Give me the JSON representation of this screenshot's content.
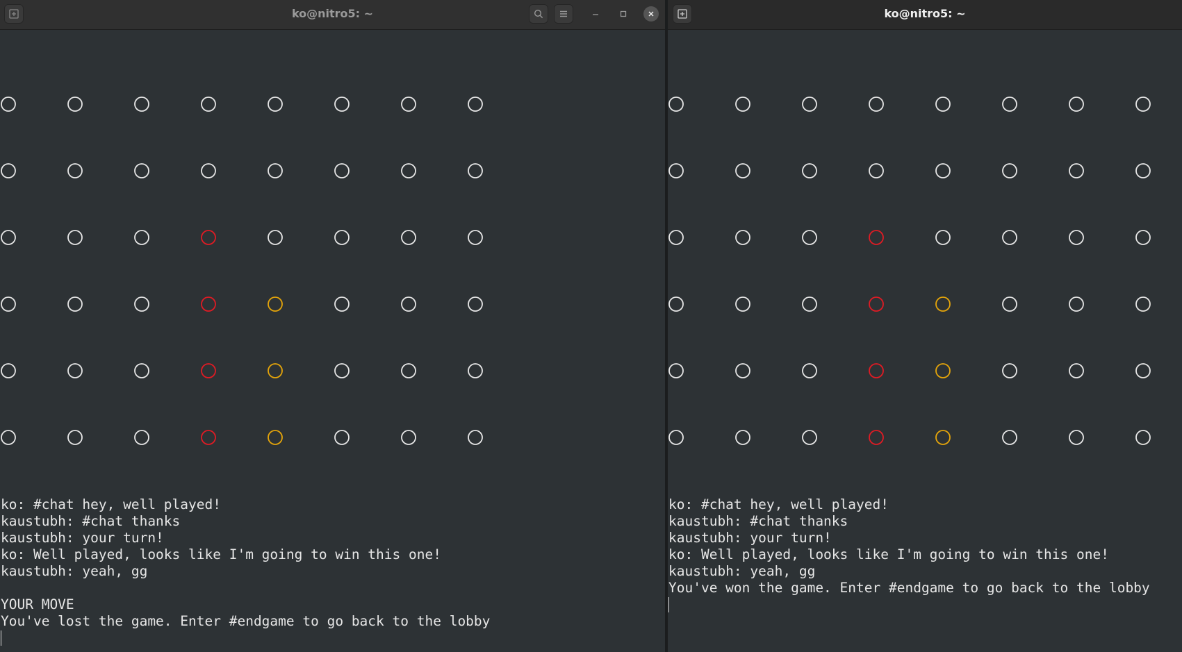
{
  "colors": {
    "background": "#2d3235",
    "text": "#e6e6e6",
    "empty_slot": "#e6e6e6",
    "red_piece": "#e01b24",
    "yellow_piece": "#e5a50a"
  },
  "board": {
    "rows": 6,
    "cols": 8,
    "cells": [
      [
        "empty",
        "empty",
        "empty",
        "empty",
        "empty",
        "empty",
        "empty",
        "empty"
      ],
      [
        "empty",
        "empty",
        "empty",
        "empty",
        "empty",
        "empty",
        "empty",
        "empty"
      ],
      [
        "empty",
        "empty",
        "empty",
        "red",
        "empty",
        "empty",
        "empty",
        "empty"
      ],
      [
        "empty",
        "empty",
        "empty",
        "red",
        "yellow",
        "empty",
        "empty",
        "empty"
      ],
      [
        "empty",
        "empty",
        "empty",
        "red",
        "yellow",
        "empty",
        "empty",
        "empty"
      ],
      [
        "empty",
        "empty",
        "empty",
        "red",
        "yellow",
        "empty",
        "empty",
        "empty"
      ]
    ]
  },
  "windows": {
    "left": {
      "title": "ko@nitro5: ~",
      "new_tab_icon": "new-tab-icon",
      "search_icon": "search-icon",
      "menu_icon": "hamburger-menu-icon",
      "minimize_icon": "minimize-icon",
      "maximize_icon": "maximize-icon",
      "close_icon": "close-icon",
      "lines": [
        "ko: #chat hey, well played!",
        "kaustubh: #chat thanks",
        "kaustubh: your turn!",
        "ko: Well played, looks like I'm going to win this one!",
        "kaustubh: yeah, gg",
        "",
        "YOUR MOVE",
        "You've lost the game. Enter #endgame to go back to the lobby"
      ]
    },
    "right": {
      "title": "ko@nitro5: ~",
      "new_tab_icon": "new-tab-icon",
      "lines": [
        "ko: #chat hey, well played!",
        "kaustubh: #chat thanks",
        "kaustubh: your turn!",
        "ko: Well played, looks like I'm going to win this one!",
        "kaustubh: yeah, gg",
        "You've won the game. Enter #endgame to go back to the lobby"
      ]
    }
  }
}
